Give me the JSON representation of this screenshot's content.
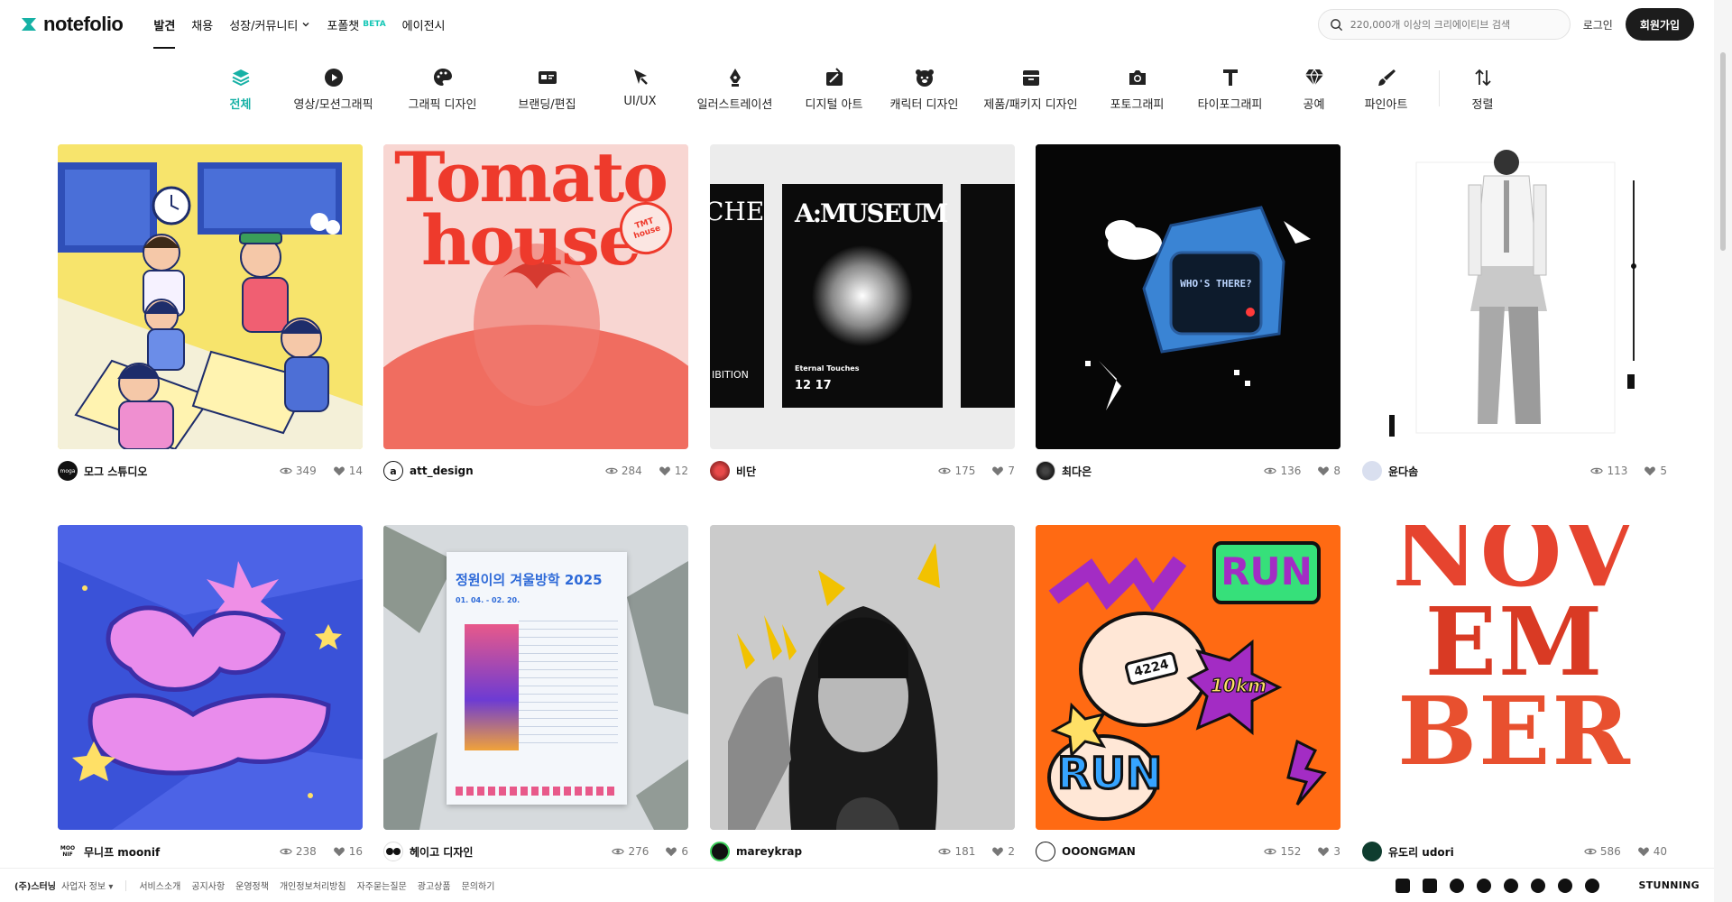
{
  "brand": {
    "name": "notefolio",
    "accent": "#16b1a5"
  },
  "nav": [
    {
      "label": "발견",
      "active": true
    },
    {
      "label": "채용"
    },
    {
      "label": "성장/커뮤니티",
      "dropdown": true
    },
    {
      "label": "포폴챗",
      "badge": "BETA"
    },
    {
      "label": "에이전시"
    }
  ],
  "search": {
    "placeholder": "220,000개 이상의 크리에이티브 검색"
  },
  "auth": {
    "login": "로그인",
    "signup": "회원가입"
  },
  "categories": [
    {
      "label": "전체",
      "icon": "layers-icon",
      "active": true
    },
    {
      "label": "영상/모션그래픽",
      "icon": "play-icon"
    },
    {
      "label": "그래픽 디자인",
      "icon": "palette-icon"
    },
    {
      "label": "브랜딩/편집",
      "icon": "id-card-icon"
    },
    {
      "label": "UI/UX",
      "icon": "cursor-icon"
    },
    {
      "label": "일러스트레이션",
      "icon": "pen-nib-icon"
    },
    {
      "label": "디지털 아트",
      "icon": "canvas-icon"
    },
    {
      "label": "캐릭터 디자인",
      "icon": "bear-icon"
    },
    {
      "label": "제품/패키지 디자인",
      "icon": "box-icon"
    },
    {
      "label": "포토그래피",
      "icon": "camera-icon"
    },
    {
      "label": "타이포그래피",
      "icon": "type-icon"
    },
    {
      "label": "공예",
      "icon": "gem-icon"
    },
    {
      "label": "파인아트",
      "icon": "brush-icon"
    }
  ],
  "sort": {
    "label": "정렬",
    "icon": "sort-icon"
  },
  "cards": [
    {
      "author": "모그 스튜디오",
      "views": "349",
      "likes": "14",
      "avatar_text": "moga",
      "colors": [
        "#f9e36a",
        "#4d6fd6",
        "#1e2d6b"
      ]
    },
    {
      "author": "att_design",
      "views": "284",
      "likes": "12",
      "avatar_text": "a",
      "title_lines": [
        "Tomato",
        "house"
      ],
      "sticker": "TMT house",
      "colors": [
        "#f7c6c2",
        "#ef3b2e"
      ]
    },
    {
      "author": "비단",
      "views": "175",
      "likes": "7",
      "poster": "A:MUSEUM",
      "poster_sub": "Eternal Touches",
      "poster_date": "12 17",
      "side_left": "CHES",
      "side_left_bottom": "IBITION",
      "colors": [
        "#ededed",
        "#0b0b0b"
      ]
    },
    {
      "author": "최다은",
      "views": "136",
      "likes": "8",
      "device_text": "WHO'S THERE?",
      "colors": [
        "#070707",
        "#3a84d4"
      ]
    },
    {
      "author": "윤다솜",
      "views": "113",
      "likes": "5",
      "colors": [
        "#ffffff",
        "#888888"
      ]
    },
    {
      "author": "무니프 moonif",
      "views": "238",
      "likes": "16",
      "avatar_text": "MOO NIF",
      "colors": [
        "#4c63e6",
        "#e98cec"
      ]
    },
    {
      "author": "헤이고 디자인",
      "views": "276",
      "likes": "6",
      "poster_title": "정원이의 겨울방학 2025",
      "poster_date": "01. 04. - 02. 20.",
      "colors": [
        "#dfe3e6",
        "#2e6ad8"
      ]
    },
    {
      "author": "mareykrap",
      "views": "181",
      "likes": "2",
      "colors": [
        "#cfcfcf",
        "#f2c200"
      ]
    },
    {
      "author": "OOONGMAN",
      "views": "152",
      "likes": "3",
      "sticker_top": "RUN",
      "sticker_bottom": "RUN",
      "bib": "4224",
      "badge": "10km",
      "colors": [
        "#ff6a13",
        "#a32cc4",
        "#36e07a"
      ]
    },
    {
      "author": "유도리 udori",
      "views": "586",
      "likes": "40",
      "letters": [
        "NOV",
        "EM",
        "BER"
      ],
      "colors": [
        "#ffffff",
        "#e23a2a"
      ]
    }
  ],
  "footer": {
    "company": "(주)스터닝",
    "biz_info": "사업자 정보",
    "links": [
      "서비스소개",
      "공지사항",
      "운영정책",
      "개인정보처리방침",
      "자주묻는질문",
      "광고상품",
      "문의하기"
    ],
    "brand": "STUNNING"
  }
}
